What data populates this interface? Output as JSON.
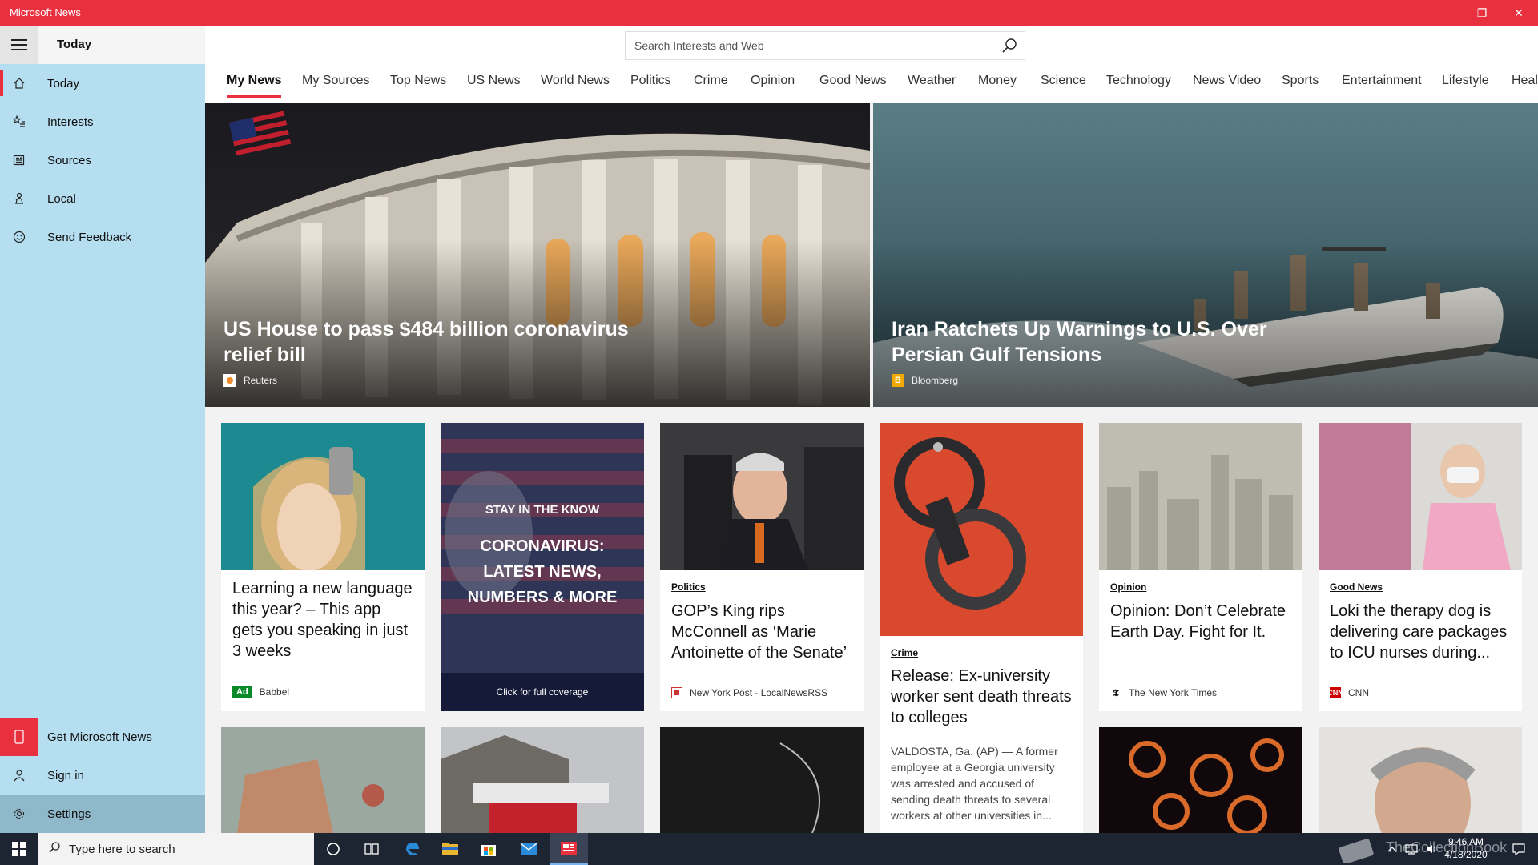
{
  "window": {
    "title": "Microsoft News",
    "minimize": "–",
    "restore": "❐",
    "close": "✕"
  },
  "sidebar": {
    "header": "Today",
    "items": [
      {
        "label": "Today",
        "icon": "home-icon"
      },
      {
        "label": "Interests",
        "icon": "star-list-icon"
      },
      {
        "label": "Sources",
        "icon": "newspaper-icon"
      },
      {
        "label": "Local",
        "icon": "location-person-icon"
      },
      {
        "label": "Send Feedback",
        "icon": "smiley-icon"
      }
    ],
    "bottom": [
      {
        "label": "Get Microsoft News",
        "icon": "phone-icon"
      },
      {
        "label": "Sign in",
        "icon": "person-icon"
      },
      {
        "label": "Settings",
        "icon": "gear-icon"
      }
    ]
  },
  "search": {
    "placeholder": "Search Interests and Web"
  },
  "tabs": [
    "My News",
    "My Sources",
    "Top News",
    "US News",
    "World News",
    "Politics",
    "Crime",
    "Opinion",
    "Good News",
    "Weather",
    "Money",
    "Science",
    "Technology",
    "News Video",
    "Sports",
    "Entertainment",
    "Lifestyle",
    "Healt"
  ],
  "heroes": [
    {
      "headline": "US House to pass $484 billion coronavirus relief bill",
      "source": "Reuters"
    },
    {
      "headline": "Iran Ratchets Up Warnings to U.S. Over Persian Gulf Tensions",
      "source": "Bloomberg"
    }
  ],
  "cards": [
    {
      "headline": "Learning a new language this year? – This app gets you speaking in just 3 weeks",
      "source": "Babbel",
      "ad": "Ad"
    },
    {
      "kicker": "STAY IN THE KNOW",
      "headline": "CORONAVIRUS: LATEST NEWS, NUMBERS & MORE",
      "cta": "Click for full coverage"
    },
    {
      "category": "Politics",
      "headline": "GOP’s King rips McConnell as ‘Marie Antoinette of the Senate’",
      "source": "New York Post - LocalNewsRSS"
    },
    {
      "category": "Crime",
      "headline": "Release: Ex-university worker sent death threats to colleges",
      "snippet": "VALDOSTA, Ga. (AP) — A former employee at a Georgia university was arrested and accused of sending death threats to several workers at other universities in..."
    },
    {
      "category": "Opinion",
      "headline": "Opinion: Don’t Celebrate Earth Day. Fight for It.",
      "source": "The New York Times"
    },
    {
      "category": "Good News",
      "headline": "Loki the therapy dog is delivering care packages to ICU nurses during...",
      "source": "CNN"
    }
  ],
  "taskbar": {
    "search_placeholder": "Type here to search",
    "time": "9:46 AM",
    "date": "4/18/2020",
    "watermark": "TheCollectionBook"
  },
  "colors": {
    "accent": "#e8303f",
    "sidebar": "#b5def0",
    "taskbar": "#1d2533"
  }
}
